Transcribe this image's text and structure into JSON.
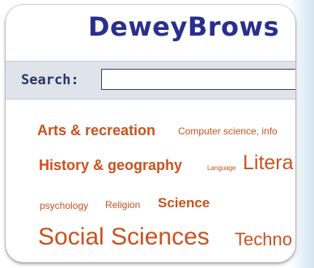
{
  "app": {
    "title": "DeweyBrows"
  },
  "search": {
    "label": "Search:",
    "value": "",
    "placeholder": ""
  },
  "tags": [
    {
      "label": "Arts & recreation"
    },
    {
      "label": "Computer science, info"
    },
    {
      "label": "History & geography"
    },
    {
      "label": "Language"
    },
    {
      "label": "Litera"
    },
    {
      "label": "psychology"
    },
    {
      "label": "Religion"
    },
    {
      "label": "Science"
    },
    {
      "label": "Social Sciences"
    },
    {
      "label": "Techno"
    }
  ],
  "colors": {
    "title": "#2a2f8c",
    "tag": "#c9521e",
    "search_bar": "#dfe3ea"
  }
}
